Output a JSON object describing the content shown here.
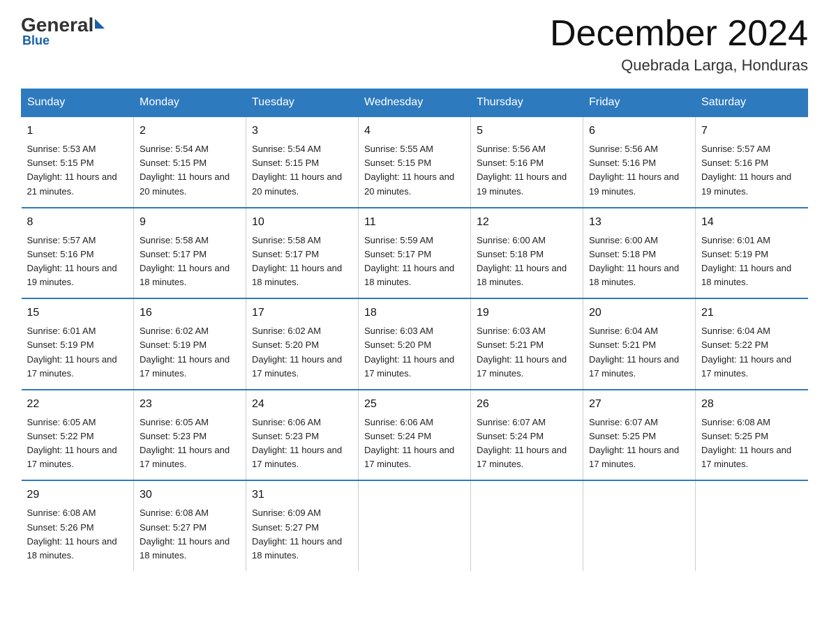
{
  "logo": {
    "general": "General",
    "blue": "Blue",
    "subtitle": "Blue"
  },
  "header": {
    "month_title": "December 2024",
    "location": "Quebrada Larga, Honduras"
  },
  "columns": [
    "Sunday",
    "Monday",
    "Tuesday",
    "Wednesday",
    "Thursday",
    "Friday",
    "Saturday"
  ],
  "weeks": [
    [
      {
        "day": "1",
        "sunrise": "Sunrise: 5:53 AM",
        "sunset": "Sunset: 5:15 PM",
        "daylight": "Daylight: 11 hours and 21 minutes."
      },
      {
        "day": "2",
        "sunrise": "Sunrise: 5:54 AM",
        "sunset": "Sunset: 5:15 PM",
        "daylight": "Daylight: 11 hours and 20 minutes."
      },
      {
        "day": "3",
        "sunrise": "Sunrise: 5:54 AM",
        "sunset": "Sunset: 5:15 PM",
        "daylight": "Daylight: 11 hours and 20 minutes."
      },
      {
        "day": "4",
        "sunrise": "Sunrise: 5:55 AM",
        "sunset": "Sunset: 5:15 PM",
        "daylight": "Daylight: 11 hours and 20 minutes."
      },
      {
        "day": "5",
        "sunrise": "Sunrise: 5:56 AM",
        "sunset": "Sunset: 5:16 PM",
        "daylight": "Daylight: 11 hours and 19 minutes."
      },
      {
        "day": "6",
        "sunrise": "Sunrise: 5:56 AM",
        "sunset": "Sunset: 5:16 PM",
        "daylight": "Daylight: 11 hours and 19 minutes."
      },
      {
        "day": "7",
        "sunrise": "Sunrise: 5:57 AM",
        "sunset": "Sunset: 5:16 PM",
        "daylight": "Daylight: 11 hours and 19 minutes."
      }
    ],
    [
      {
        "day": "8",
        "sunrise": "Sunrise: 5:57 AM",
        "sunset": "Sunset: 5:16 PM",
        "daylight": "Daylight: 11 hours and 19 minutes."
      },
      {
        "day": "9",
        "sunrise": "Sunrise: 5:58 AM",
        "sunset": "Sunset: 5:17 PM",
        "daylight": "Daylight: 11 hours and 18 minutes."
      },
      {
        "day": "10",
        "sunrise": "Sunrise: 5:58 AM",
        "sunset": "Sunset: 5:17 PM",
        "daylight": "Daylight: 11 hours and 18 minutes."
      },
      {
        "day": "11",
        "sunrise": "Sunrise: 5:59 AM",
        "sunset": "Sunset: 5:17 PM",
        "daylight": "Daylight: 11 hours and 18 minutes."
      },
      {
        "day": "12",
        "sunrise": "Sunrise: 6:00 AM",
        "sunset": "Sunset: 5:18 PM",
        "daylight": "Daylight: 11 hours and 18 minutes."
      },
      {
        "day": "13",
        "sunrise": "Sunrise: 6:00 AM",
        "sunset": "Sunset: 5:18 PM",
        "daylight": "Daylight: 11 hours and 18 minutes."
      },
      {
        "day": "14",
        "sunrise": "Sunrise: 6:01 AM",
        "sunset": "Sunset: 5:19 PM",
        "daylight": "Daylight: 11 hours and 18 minutes."
      }
    ],
    [
      {
        "day": "15",
        "sunrise": "Sunrise: 6:01 AM",
        "sunset": "Sunset: 5:19 PM",
        "daylight": "Daylight: 11 hours and 17 minutes."
      },
      {
        "day": "16",
        "sunrise": "Sunrise: 6:02 AM",
        "sunset": "Sunset: 5:19 PM",
        "daylight": "Daylight: 11 hours and 17 minutes."
      },
      {
        "day": "17",
        "sunrise": "Sunrise: 6:02 AM",
        "sunset": "Sunset: 5:20 PM",
        "daylight": "Daylight: 11 hours and 17 minutes."
      },
      {
        "day": "18",
        "sunrise": "Sunrise: 6:03 AM",
        "sunset": "Sunset: 5:20 PM",
        "daylight": "Daylight: 11 hours and 17 minutes."
      },
      {
        "day": "19",
        "sunrise": "Sunrise: 6:03 AM",
        "sunset": "Sunset: 5:21 PM",
        "daylight": "Daylight: 11 hours and 17 minutes."
      },
      {
        "day": "20",
        "sunrise": "Sunrise: 6:04 AM",
        "sunset": "Sunset: 5:21 PM",
        "daylight": "Daylight: 11 hours and 17 minutes."
      },
      {
        "day": "21",
        "sunrise": "Sunrise: 6:04 AM",
        "sunset": "Sunset: 5:22 PM",
        "daylight": "Daylight: 11 hours and 17 minutes."
      }
    ],
    [
      {
        "day": "22",
        "sunrise": "Sunrise: 6:05 AM",
        "sunset": "Sunset: 5:22 PM",
        "daylight": "Daylight: 11 hours and 17 minutes."
      },
      {
        "day": "23",
        "sunrise": "Sunrise: 6:05 AM",
        "sunset": "Sunset: 5:23 PM",
        "daylight": "Daylight: 11 hours and 17 minutes."
      },
      {
        "day": "24",
        "sunrise": "Sunrise: 6:06 AM",
        "sunset": "Sunset: 5:23 PM",
        "daylight": "Daylight: 11 hours and 17 minutes."
      },
      {
        "day": "25",
        "sunrise": "Sunrise: 6:06 AM",
        "sunset": "Sunset: 5:24 PM",
        "daylight": "Daylight: 11 hours and 17 minutes."
      },
      {
        "day": "26",
        "sunrise": "Sunrise: 6:07 AM",
        "sunset": "Sunset: 5:24 PM",
        "daylight": "Daylight: 11 hours and 17 minutes."
      },
      {
        "day": "27",
        "sunrise": "Sunrise: 6:07 AM",
        "sunset": "Sunset: 5:25 PM",
        "daylight": "Daylight: 11 hours and 17 minutes."
      },
      {
        "day": "28",
        "sunrise": "Sunrise: 6:08 AM",
        "sunset": "Sunset: 5:25 PM",
        "daylight": "Daylight: 11 hours and 17 minutes."
      }
    ],
    [
      {
        "day": "29",
        "sunrise": "Sunrise: 6:08 AM",
        "sunset": "Sunset: 5:26 PM",
        "daylight": "Daylight: 11 hours and 18 minutes."
      },
      {
        "day": "30",
        "sunrise": "Sunrise: 6:08 AM",
        "sunset": "Sunset: 5:27 PM",
        "daylight": "Daylight: 11 hours and 18 minutes."
      },
      {
        "day": "31",
        "sunrise": "Sunrise: 6:09 AM",
        "sunset": "Sunset: 5:27 PM",
        "daylight": "Daylight: 11 hours and 18 minutes."
      },
      null,
      null,
      null,
      null
    ]
  ]
}
